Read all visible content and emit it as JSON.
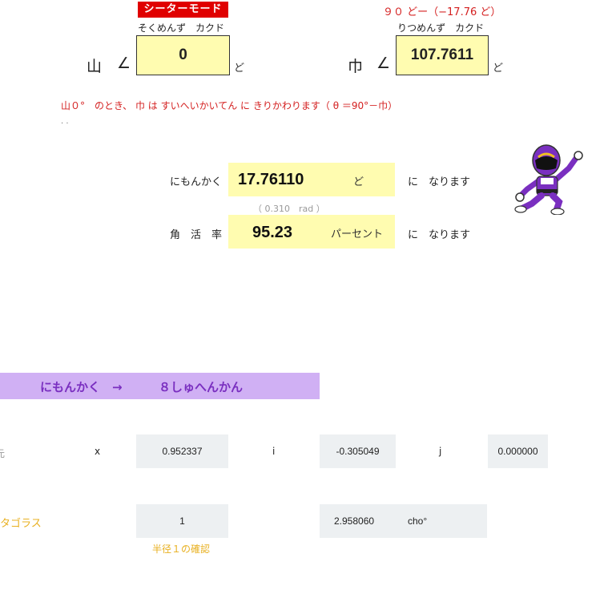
{
  "header": {
    "mode_badge": "シーターモード",
    "right_note": "９０ どー（−17.76 ど）",
    "left_col_label": "そくめんず　カクド",
    "right_col_label": "りつめんず　カクド"
  },
  "inputs": {
    "yama_char": "山",
    "haba_char": "巾",
    "angle_symbol": "∠",
    "yama_value": "0",
    "haba_value": "107.7611",
    "degree_unit": "ど"
  },
  "note": {
    "text": "山０°　のとき、 巾 は すいへいかいてん に きりかわります（ θ ＝90°－巾）",
    "dots": ". ."
  },
  "results": {
    "dihedral": {
      "label": "にもんかく",
      "value": "17.76110",
      "unit": "ど",
      "suffix": "に　なります",
      "rad_note": "（ 0.310　rad ）"
    },
    "slope": {
      "label": "角　活　率",
      "value": "95.23",
      "unit": "パーセント",
      "suffix": "に　なります"
    }
  },
  "section": {
    "left": "にもんかく　→",
    "right": "８しゅへんかん"
  },
  "vector": {
    "row_prefix": "元",
    "x_label": "x",
    "x_value": "0.952337",
    "i_label": "i",
    "i_value": "-0.305049",
    "j_label": "j",
    "j_value": "0.000000"
  },
  "pythagoras": {
    "label": "タゴラス",
    "value": "1",
    "value2": "2.958060",
    "unit2": "cho°",
    "note": "半径１の確認"
  },
  "colors": {
    "input_yellow": "#fffcb0",
    "red": "#d42020",
    "purple": "#7a2fc0",
    "banner": "#d0b0f4",
    "gold": "#e8b020",
    "grey_cell": "#edf0f2"
  },
  "icons": {
    "mascot": "purple-ranger-icon"
  }
}
